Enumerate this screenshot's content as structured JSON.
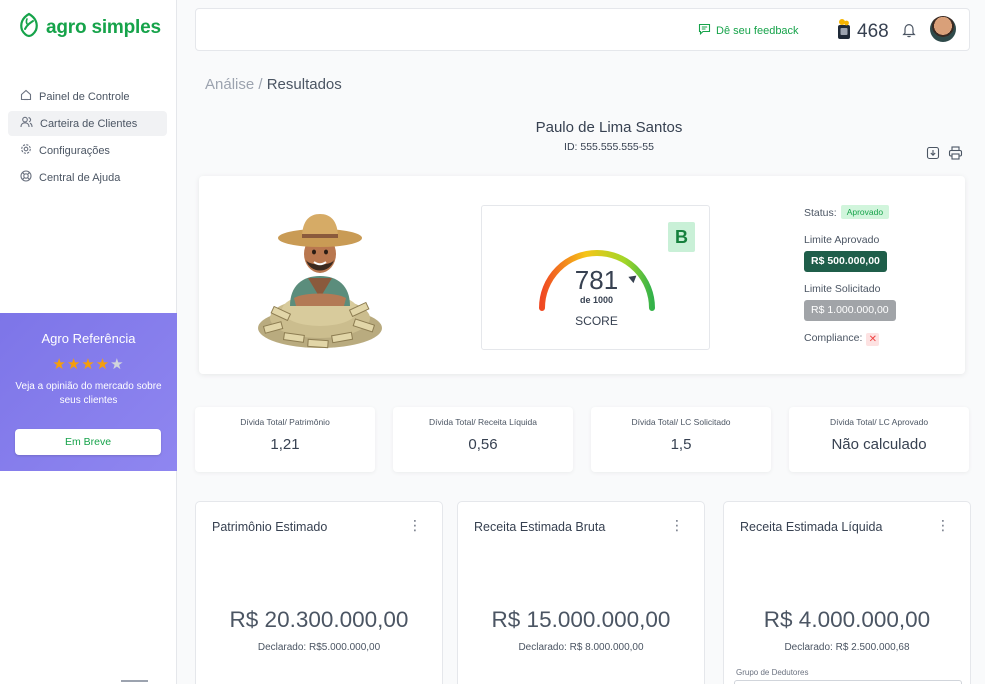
{
  "app": {
    "name": "agro simples"
  },
  "sidebar": {
    "items": [
      {
        "label": "Painel de Controle",
        "icon": "home-icon",
        "active": false
      },
      {
        "label": "Carteira de Clientes",
        "icon": "users-icon",
        "active": true
      },
      {
        "label": "Configurações",
        "icon": "gear-icon",
        "active": false
      },
      {
        "label": "Central de Ajuda",
        "icon": "lifebuoy-icon",
        "active": false
      }
    ],
    "promo": {
      "title": "Agro Referência",
      "rating": 4,
      "rating_max": 5,
      "text": "Veja a opinião do mercado sobre seus clientes",
      "button": "Em Breve"
    }
  },
  "header": {
    "feedback": "Dê seu feedback",
    "coins": "468"
  },
  "breadcrumb": {
    "parent": "Análise",
    "separator": " / ",
    "current": "Resultados"
  },
  "client": {
    "name": "Paulo de Lima Santos",
    "id": "ID: 555.555.555-55"
  },
  "score": {
    "grade": "B",
    "value": "781",
    "of": "de 1000",
    "label": "SCORE",
    "fraction": 0.781
  },
  "info": {
    "status_label": "Status:",
    "status_value": "Aprovado",
    "limit_approved_label": "Limite Aprovado",
    "limit_approved_value": "R$ 500.000,00",
    "limit_requested_label": "Limite Solicitado",
    "limit_requested_value": "R$ 1.000.000,00",
    "compliance_label": "Compliance:",
    "compliance_value": "✕"
  },
  "metrics": [
    {
      "label": "Dívida Total/ Patrimônio",
      "value": "1,21"
    },
    {
      "label": "Dívida Total/ Receita Líquida",
      "value": "0,56"
    },
    {
      "label": "Dívida Total/ LC Solicitado",
      "value": "1,5"
    },
    {
      "label": "Dívida Total/ LC Aprovado",
      "value": "Não calculado"
    }
  ],
  "cards": [
    {
      "title": "Patrimônio Estimado",
      "value": "R$ 20.300.000,00",
      "declared": "Declarado: R$5.000.000,00",
      "extra": ""
    },
    {
      "title": "Receita Estimada Bruta",
      "value": "R$ 15.000.000,00",
      "declared": "Declarado: R$ 8.000.000,00",
      "extra": ""
    },
    {
      "title": "Receita Estimada Líquida",
      "value": "R$ 4.000.000,00",
      "declared": "Declarado: R$ 2.500.000,68",
      "extra": "Grupo de Dedutores"
    }
  ],
  "colors": {
    "brand": "#16a34a",
    "promo": "#7d75e8",
    "limit_approved": "#1f5e4a",
    "limit_requested": "#a1a4a8"
  }
}
